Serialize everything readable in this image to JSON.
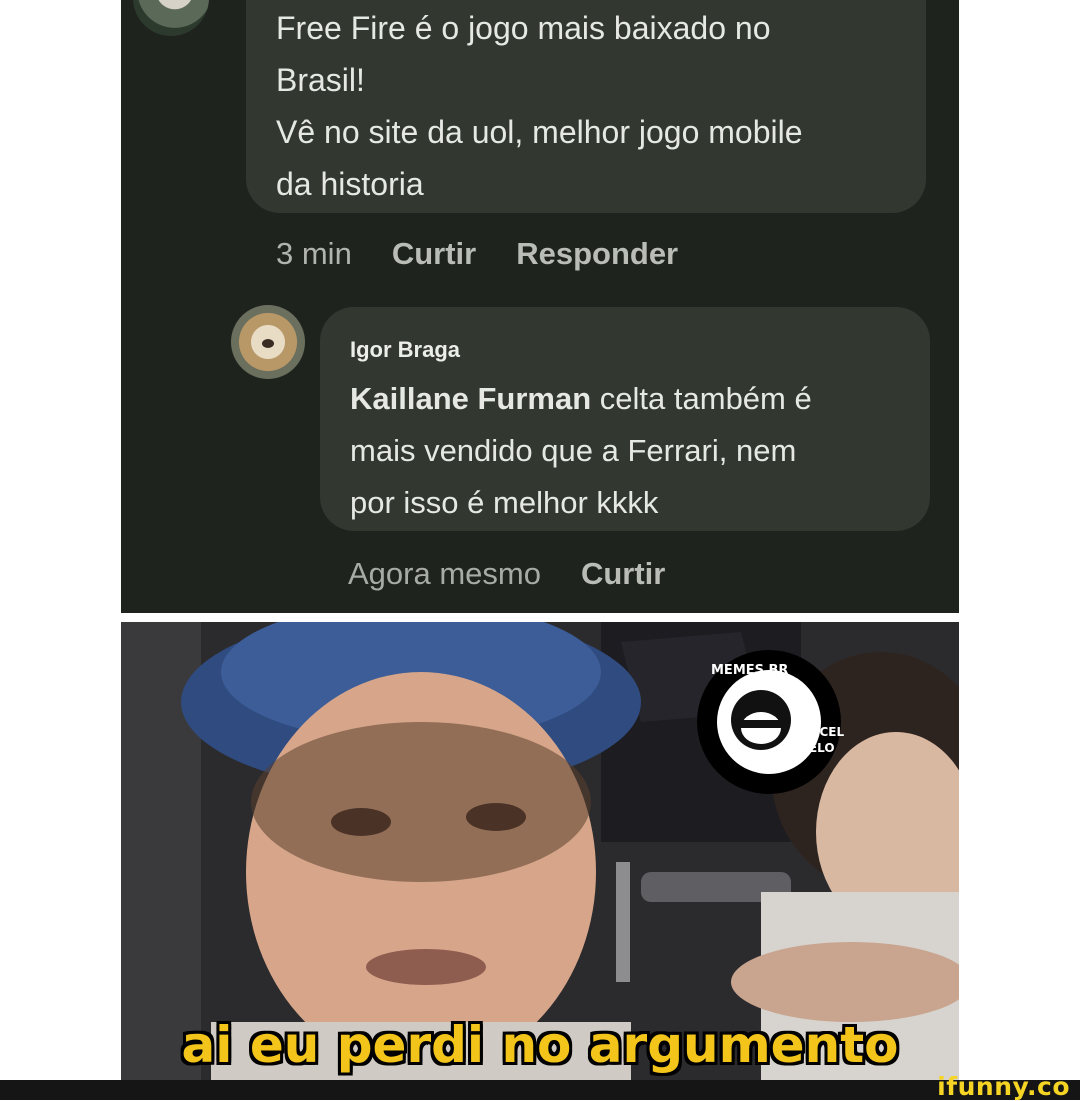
{
  "comment_top": {
    "lines": [
      "Free Fire é o jogo mais baixado no",
      "Brasil!",
      "Vê no site da uol, melhor jogo mobile",
      "da historia"
    ],
    "time": "3 min",
    "like_label": "Curtir",
    "reply_label": "Responder"
  },
  "comment_reply": {
    "author": "Igor Braga",
    "mention": "Kaillane Furman",
    "line1_rest": " celta também é",
    "line2": "mais vendido que a Ferrari, nem",
    "line3": "por isso é melhor kkkk",
    "time": "Agora mesmo",
    "like_label": "Curtir"
  },
  "meme": {
    "caption": "ai eu perdi no argumento",
    "watermark_ring": "MEMES BR",
    "watermark_name": [
      "MARCEL",
      "MELO"
    ]
  },
  "footer": {
    "logo": "ifunny.co"
  },
  "colors": {
    "panel_bg": "#1f231e",
    "bubble_bg": "#323830",
    "caption": "#f3c51a",
    "ifunny_yellow": "#f5d424"
  }
}
